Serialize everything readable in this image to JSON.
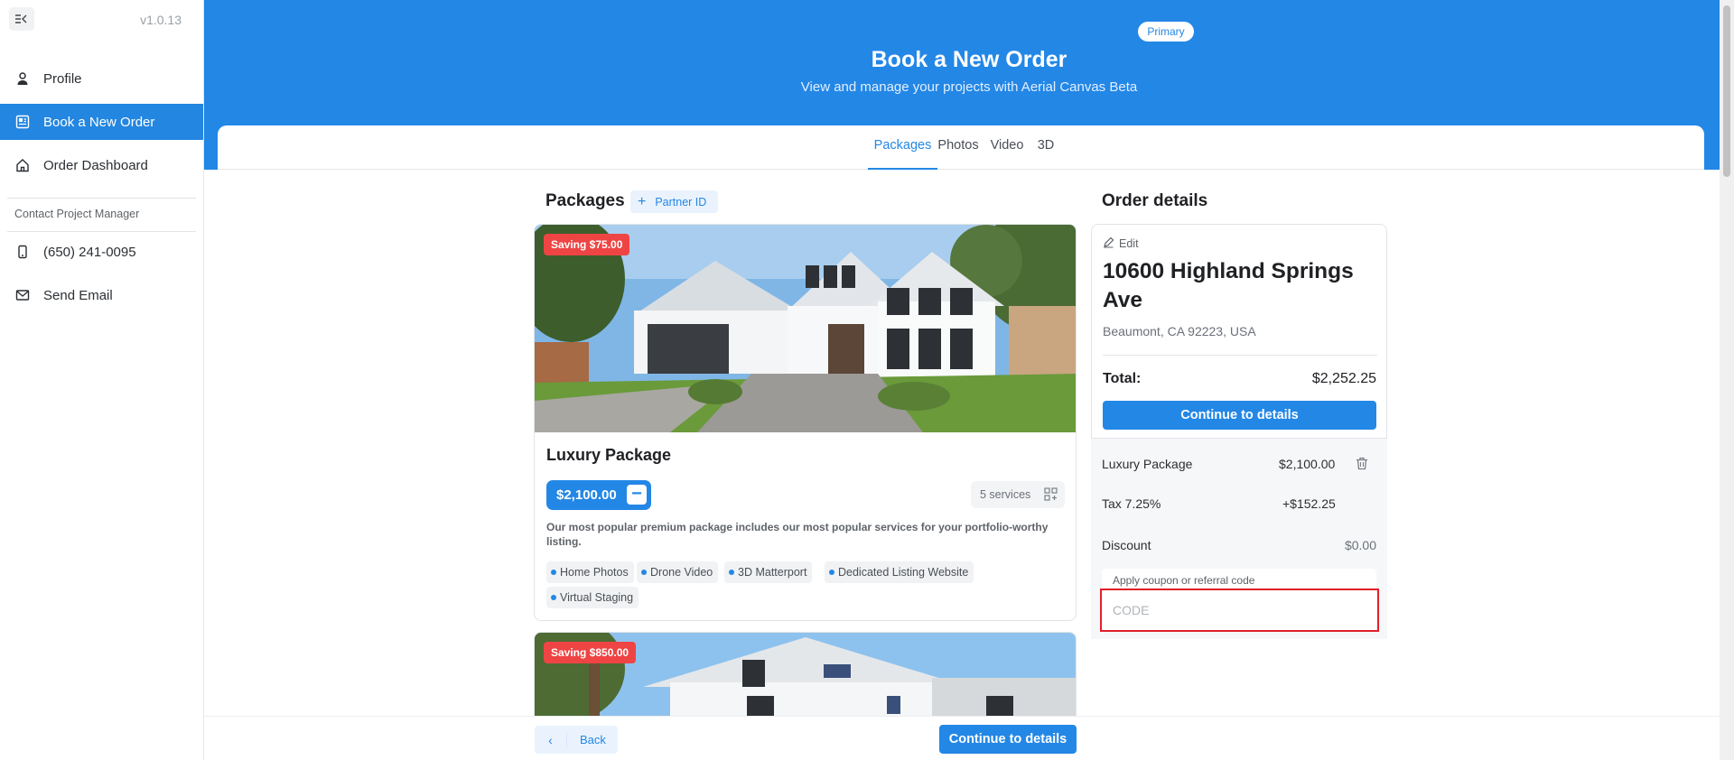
{
  "sidebar": {
    "version": "v1.0.13",
    "items": [
      {
        "label": "Profile",
        "icon": "user-icon"
      },
      {
        "label": "Book a New Order",
        "icon": "order-icon",
        "active": true
      },
      {
        "label": "Order Dashboard",
        "icon": "home-icon"
      }
    ],
    "contact_caption": "Contact Project Manager",
    "contact_items": [
      {
        "label": "(650) 241-0095",
        "icon": "phone-icon"
      },
      {
        "label": "Send Email",
        "icon": "mail-icon"
      }
    ]
  },
  "header": {
    "badge": "Primary",
    "title": "Book a New Order",
    "subtitle": "View and manage your projects with Aerial Canvas Beta"
  },
  "tabs": [
    "Packages",
    "Photos",
    "Video",
    "3D"
  ],
  "packages": {
    "title": "Packages",
    "partner_button": "Partner ID",
    "list": [
      {
        "saving": "Saving $75.00",
        "name": "Luxury Package",
        "price": "$2,100.00",
        "services": "5 services",
        "description": "Our most popular premium package includes our most popular services for your portfolio-worthy listing.",
        "features": [
          "Home Photos",
          "Drone Video",
          "3D Matterport",
          "Dedicated Listing Website",
          "Virtual Staging"
        ]
      },
      {
        "saving": "Saving $850.00"
      }
    ]
  },
  "order": {
    "title": "Order details",
    "edit_label": "Edit",
    "address_line1": "10600 Highland Springs Ave",
    "address_line2": "Beaumont, CA 92223, USA",
    "total_label": "Total:",
    "total_value": "$2,252.25",
    "continue_label": "Continue to details",
    "line_item_name": "Luxury Package",
    "line_item_price": "$2,100.00",
    "tax_label": "Tax 7.25%",
    "tax_value": "+$152.25",
    "discount_label": "Discount",
    "discount_value": "$0.00",
    "coupon_label": "Apply coupon or referral code",
    "code_placeholder": "CODE",
    "code_value": ""
  },
  "footer": {
    "back_label": "Back",
    "continue_label": "Continue to details"
  },
  "colors": {
    "accent": "#2387e6",
    "saving_badge": "#ef4444",
    "focus_outline": "#e0202a"
  }
}
